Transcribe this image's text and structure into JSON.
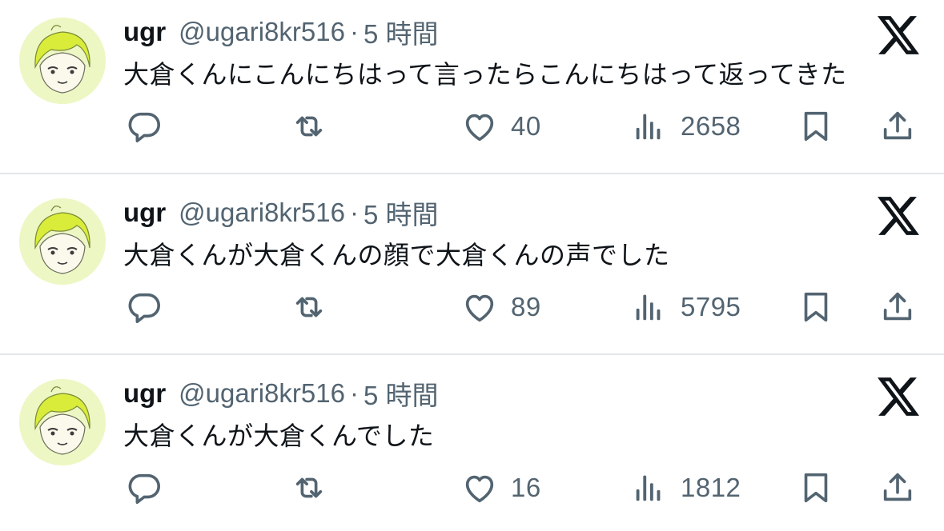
{
  "colors": {
    "text_primary": "#0f1419",
    "text_secondary": "#536471",
    "divider": "#e3e6e8",
    "avatar_bg": "#edf7c4",
    "avatar_hair": "#d9ec3a"
  },
  "tweets": [
    {
      "name": "ugr",
      "handle": "@ugari8kr516",
      "separator": "·",
      "time": "5 時間",
      "text": "大倉くんにこんにちはって言ったらこんにちはって返ってきた",
      "likes": "40",
      "views": "2658",
      "icons": [
        "reply-icon",
        "retweet-icon",
        "like-icon",
        "views-icon",
        "bookmark-icon",
        "share-icon",
        "x-logo-icon"
      ]
    },
    {
      "name": "ugr",
      "handle": "@ugari8kr516",
      "separator": "·",
      "time": "5 時間",
      "text": "大倉くんが大倉くんの顔で大倉くんの声でした",
      "likes": "89",
      "views": "5795",
      "icons": [
        "reply-icon",
        "retweet-icon",
        "like-icon",
        "views-icon",
        "bookmark-icon",
        "share-icon",
        "x-logo-icon"
      ]
    },
    {
      "name": "ugr",
      "handle": "@ugari8kr516",
      "separator": "·",
      "time": "5 時間",
      "text": "大倉くんが大倉くんでした",
      "likes": "16",
      "views": "1812",
      "icons": [
        "reply-icon",
        "retweet-icon",
        "like-icon",
        "views-icon",
        "bookmark-icon",
        "share-icon",
        "x-logo-icon"
      ]
    }
  ]
}
